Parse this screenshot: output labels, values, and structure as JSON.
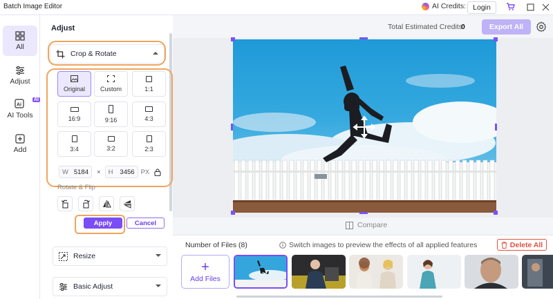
{
  "titlebar": {
    "title": "Batch Image Editor",
    "credits_label": "AI Credits:",
    "login_label": "Login",
    "icons": [
      "cart-icon",
      "maximize-icon",
      "close-icon"
    ]
  },
  "rail": {
    "items": [
      {
        "label": "All",
        "icon": "grid-icon",
        "active": true
      },
      {
        "label": "Adjust",
        "icon": "sliders-icon"
      },
      {
        "label": "AI Tools",
        "icon": "ai-icon",
        "badge": "AI"
      },
      {
        "label": "Add",
        "icon": "add-icon"
      }
    ]
  },
  "panel": {
    "title": "Adjust",
    "crop_rotate": {
      "label": "Crop & Rotate",
      "ratios": [
        {
          "label": "Original",
          "active": true
        },
        {
          "label": "Custom"
        },
        {
          "label": "1:1"
        },
        {
          "label": "16:9"
        },
        {
          "label": "9:16"
        },
        {
          "label": "4:3"
        },
        {
          "label": "3:4"
        },
        {
          "label": "3:2"
        },
        {
          "label": "2:3"
        }
      ],
      "width_label": "W",
      "width_value": "5184",
      "times": "×",
      "height_label": "H",
      "height_value": "3456",
      "unit": "PX",
      "rotate_flip_label": "Rotate & Flip",
      "apply_label": "Apply",
      "cancel_label": "Cancel"
    },
    "resize_label": "Resize",
    "basic_adjust_label": "Basic Adjust"
  },
  "main": {
    "estimated_label": "Total Estimated Credits:",
    "estimated_value": "0",
    "export_label": "Export All",
    "compare_label": "Compare",
    "files_count_label": "Number of Files (8)",
    "tip_text": "Switch images to preview the effects of all applied features",
    "delete_label": "Delete All",
    "add_files_label": "Add Files"
  },
  "colors": {
    "accent": "#7a4df5",
    "highlight": "#f0a45c",
    "danger": "#e2503f"
  }
}
